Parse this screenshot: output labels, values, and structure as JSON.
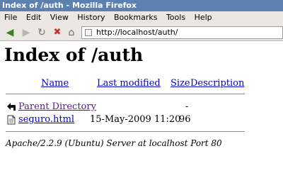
{
  "window": {
    "title": "Index of /auth - Mozilla Firefox"
  },
  "menu": [
    "File",
    "Edit",
    "View",
    "History",
    "Bookmarks",
    "Tools",
    "Help"
  ],
  "url": "http://localhost/auth/",
  "page": {
    "heading": "Index of /auth",
    "columns": {
      "name": "Name",
      "modified": "Last modified",
      "size": "Size",
      "description": "Description"
    },
    "rows": [
      {
        "icon": "back-arrow-icon",
        "name": "Parent Directory",
        "modified": "",
        "size": "-",
        "description": ""
      },
      {
        "icon": "file-icon",
        "name": "seguro.html",
        "modified": "15-May-2009 11:20",
        "size": "96",
        "description": ""
      }
    ],
    "footer": "Apache/2.2.9 (Ubuntu) Server at localhost Port 80"
  }
}
